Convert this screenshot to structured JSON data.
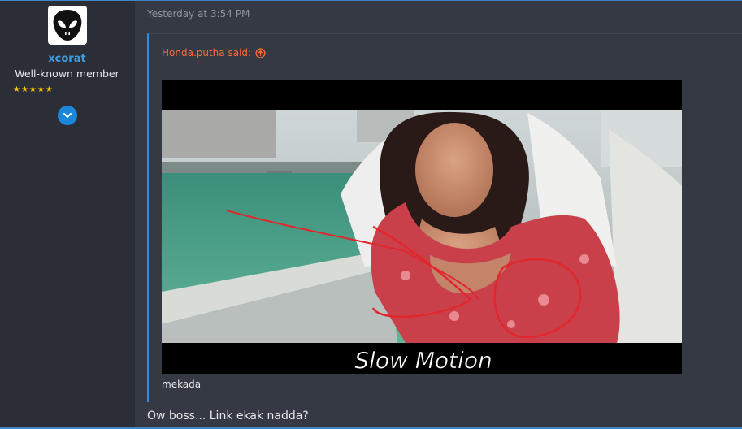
{
  "user": {
    "username": "xcorat",
    "title": "Well-known member",
    "stars": "★★★★★",
    "avatar_icon": "alien-head-icon",
    "expand_icon": "chevron-down-icon"
  },
  "post": {
    "timestamp": "Yesterday at 3:54 PM",
    "quote": {
      "author_said": "Honda.putha said:",
      "jump_icon": "arrow-up-circle-icon",
      "image_overlay_text": "Slow Motion",
      "caption": "mekada"
    },
    "reply": "Ow boss... Link ekak nadda?"
  },
  "colors": {
    "accent_blue": "#3d85c6",
    "quote_author": "#ff6a3d",
    "username": "#3d9be0",
    "stars": "#f2c200"
  }
}
